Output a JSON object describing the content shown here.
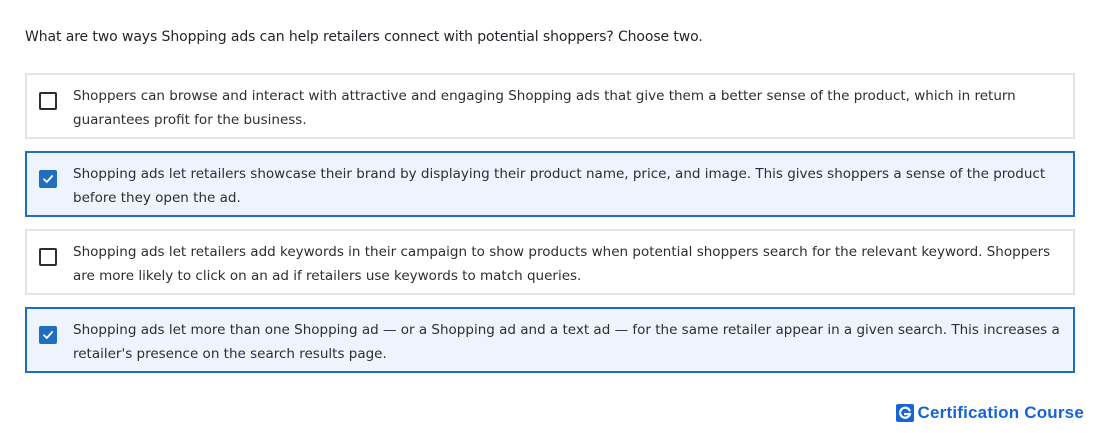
{
  "question": "What are two ways Shopping ads can help retailers connect with potential shoppers? Choose two.",
  "options": [
    {
      "text": "Shoppers can browse and interact with attractive and engaging Shopping ads that give them a better sense of the product, which in return guarantees profit for the business.",
      "checked": false
    },
    {
      "text": "Shopping ads let retailers showcase their brand by displaying their product name, price, and image. This gives shoppers a sense of the product before they open the ad.",
      "checked": true
    },
    {
      "text": "Shopping ads let retailers add keywords in their campaign to show products when potential shoppers search for the relevant keyword. Shoppers are more likely to click on an ad if retailers use keywords to match queries.",
      "checked": false
    },
    {
      "text": "Shopping ads let more than one Shopping ad — or a Shopping ad and a text ad — for the same retailer appear in a given search. This increases a retailer's presence on the search results page.",
      "checked": true
    }
  ],
  "brand": {
    "logo_icon": "g-logo-icon",
    "label": "Certification Course"
  },
  "colors": {
    "accent": "#1f6ec0",
    "selected_bg": "#edf4fd",
    "border": "#e2e4e7",
    "brand": "#1565d8"
  }
}
